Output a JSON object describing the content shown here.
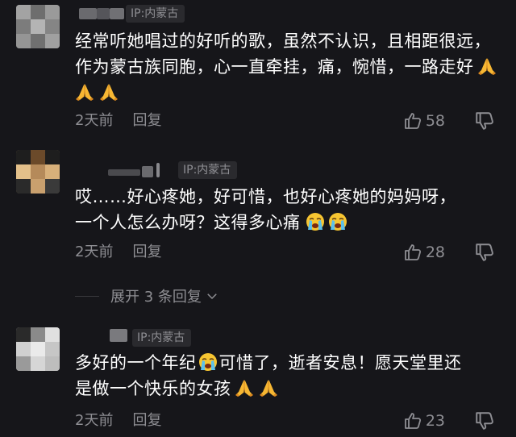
{
  "comments": [
    {
      "ip": "IP:内蒙古",
      "text_parts": [
        "经常听她唱过的好听的歌，虽然不认识，且相距很远，作为蒙古族同胞，心一直牵挂，痛，惋惜，一路走好"
      ],
      "emojis": [
        "pray-emoji",
        "pray-emoji",
        "pray-emoji"
      ],
      "time": "2天前",
      "reply_label": "回复",
      "likes": "58"
    },
    {
      "ip": "IP:内蒙古",
      "text_line1": "哎……好心疼她，好可惜，也好心疼她的妈妈呀，",
      "text_line2": "一个人怎么办呀？这得多心痛",
      "emojis": [
        "crying-emoji",
        "crying-emoji"
      ],
      "time": "2天前",
      "reply_label": "回复",
      "likes": "28"
    },
    {
      "ip": "IP:内蒙古",
      "text_a": "多好的一个年纪",
      "text_b": "可惜了，逝者安息！愿天堂里还",
      "text_c": "是做一个快乐的女孩",
      "emojis": [
        "crying-emoji",
        "pray-emoji",
        "pray-emoji"
      ],
      "time": "2天前",
      "reply_label": "回复",
      "likes": "23"
    }
  ],
  "expand_replies": "展开 3 条回复",
  "colors": {
    "background": "#16161a",
    "text": "#ffffff",
    "meta": "#8e8e93",
    "badge_bg": "#2a2a2e"
  },
  "icons": {
    "like": "thumbs-up-icon",
    "dislike": "thumbs-down-icon",
    "expand": "chevron-down-icon"
  }
}
